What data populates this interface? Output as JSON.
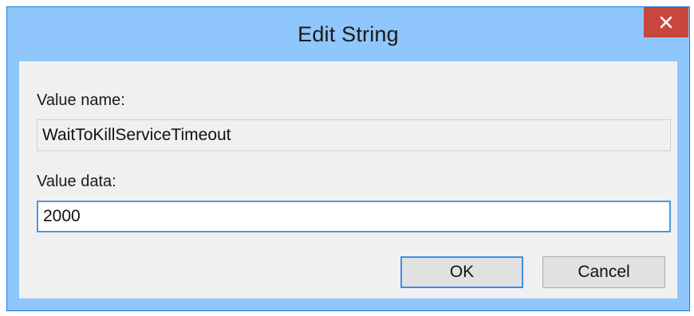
{
  "window": {
    "title": "Edit String",
    "close_icon": "close-icon"
  },
  "form": {
    "value_name_label": "Value name:",
    "value_name": "WaitToKillServiceTimeout",
    "value_data_label": "Value data:",
    "value_data": "2000"
  },
  "buttons": {
    "ok_label": "OK",
    "cancel_label": "Cancel"
  },
  "colors": {
    "titlebar": "#8fc6fb",
    "close_button": "#c9463d",
    "window_background": "#f0f0f0",
    "focus_border": "#4a97e0"
  }
}
